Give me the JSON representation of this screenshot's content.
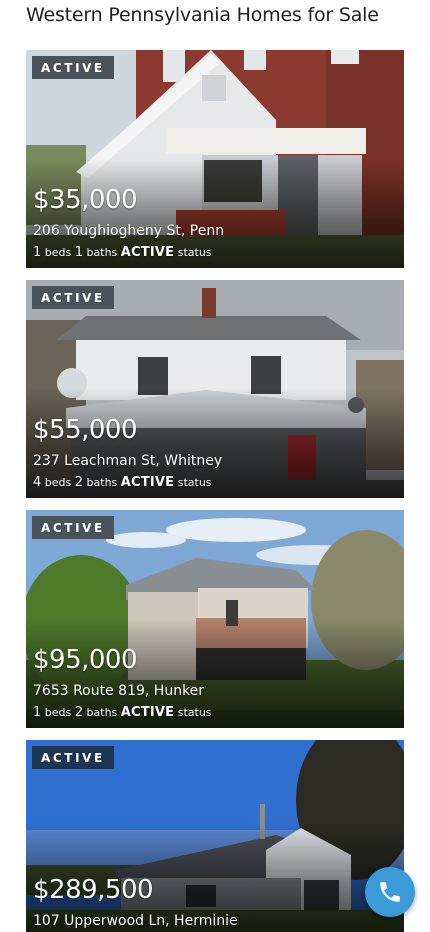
{
  "page": {
    "title": "Western Pennsylvania Homes for Sale"
  },
  "colors": {
    "badge_gray": "#4c5259",
    "badge_navy": "#1d3550",
    "call_button": "#3b9bd9"
  },
  "listings": [
    {
      "badge": "ACTIVE",
      "price": "$35,000",
      "address": "206 Youghiogheny St, Penn",
      "beds": "1",
      "beds_label": "beds",
      "baths": "1",
      "baths_label": "baths",
      "status": "ACTIVE",
      "status_label": "status"
    },
    {
      "badge": "ACTIVE",
      "price": "$55,000",
      "address": "237 Leachman St, Whitney",
      "beds": "4",
      "beds_label": "beds",
      "baths": "2",
      "baths_label": "baths",
      "status": "ACTIVE",
      "status_label": "status"
    },
    {
      "badge": "ACTIVE",
      "price": "$95,000",
      "address": "7653 Route 819, Hunker",
      "beds": "1",
      "beds_label": "beds",
      "baths": "2",
      "baths_label": "baths",
      "status": "ACTIVE",
      "status_label": "status"
    },
    {
      "badge": "ACTIVE",
      "price": "$289,500",
      "address": "107 Upperwood Ln, Herminie"
    }
  ],
  "fab": {
    "icon": "phone-icon"
  }
}
